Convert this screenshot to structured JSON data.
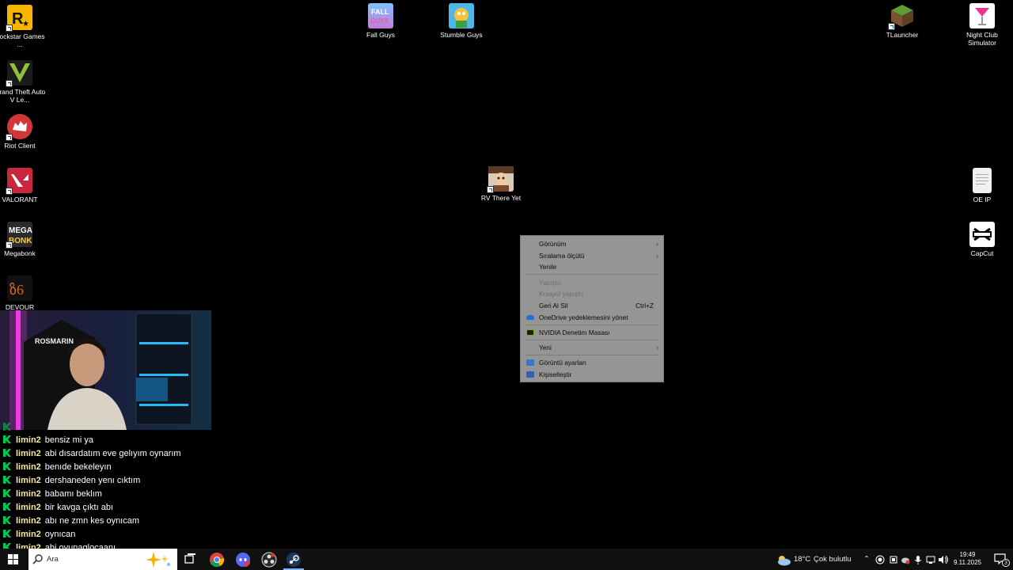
{
  "desktop_icons": {
    "rockstar": "Rockstar Games ...",
    "gta": "Grand Theft Auto V Le...",
    "riot": "Riot Client",
    "valorant": "VALORANT",
    "megabonk": "Megabonk",
    "devour": "DEVOUR",
    "fallguys": "Fall Guys",
    "stumble": "Stumble Guys",
    "rv": "RV There Yet",
    "tlauncher": "TLauncher",
    "nightclub": "Night Club Simulator",
    "oeip": "OE IP",
    "capcut": "CapCut"
  },
  "context_menu": {
    "view": "Görünüm",
    "sort": "Sıralama ölçütü",
    "refresh": "Yenile",
    "paste": "Yapıştır",
    "paste_shortcut": "Kısayol yapıştır",
    "undo": "Geri Al Sil",
    "undo_key": "Ctrl+Z",
    "onedrive": "OneDrive yedeklemesini yönet",
    "nvidia": "NVIDIA Denetim Masası",
    "new": "Yeni",
    "display": "Görüntü ayarları",
    "personalize": "Kişiselleştir"
  },
  "chat": {
    "messages": [
      {
        "user": "limin2",
        "text": "bensiz mi ya"
      },
      {
        "user": "limin2",
        "text": "abi dısardatım eve gelıyım oynarım"
      },
      {
        "user": "limin2",
        "text": "benıde bekeleyın"
      },
      {
        "user": "limin2",
        "text": "dershaneden yenı cıktım"
      },
      {
        "user": "limin2",
        "text": "babamı beklım"
      },
      {
        "user": "limin2",
        "text": "bir kavga çıktı abı"
      },
      {
        "user": "limin2",
        "text": "abı ne zmn kes oynıcam"
      },
      {
        "user": "limin2",
        "text": "oynıcan"
      },
      {
        "user": "limin2",
        "text": "abi oyunaglocaanı"
      }
    ]
  },
  "taskbar": {
    "search_placeholder": "Ara",
    "temperature": "18°C",
    "weather": "Çok bulutlu",
    "time": "19:49",
    "date": "9.11.2025",
    "notification_count": "3"
  },
  "colors": {
    "menu_bg": "#959595",
    "chat_badge": "#00c853",
    "chat_user": "#f5e9a8"
  }
}
